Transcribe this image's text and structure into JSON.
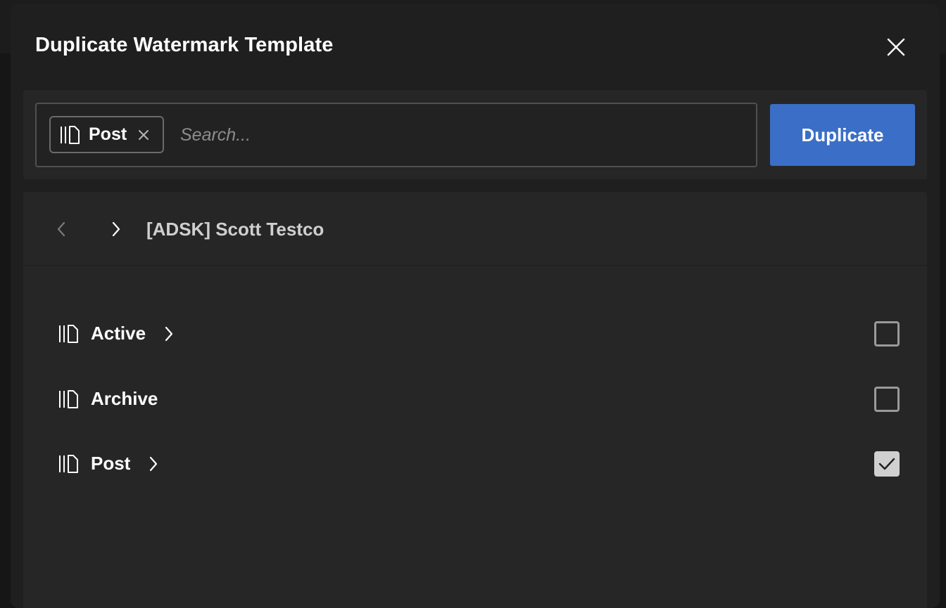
{
  "modal": {
    "title": "Duplicate Watermark Template"
  },
  "search": {
    "chip_label": "Post",
    "placeholder": "Search...",
    "value": ""
  },
  "actions": {
    "duplicate_label": "Duplicate"
  },
  "navigation": {
    "breadcrumb": "[ADSK] Scott Testco"
  },
  "list": {
    "items": [
      {
        "label": "Active",
        "icon": "folder-library-icon",
        "has_children": true,
        "checked": false
      },
      {
        "label": "Archive",
        "icon": "folder-library-icon",
        "has_children": false,
        "checked": false
      },
      {
        "label": "Post",
        "icon": "folder-library-icon",
        "has_children": true,
        "checked": true
      }
    ]
  },
  "colors": {
    "accent": "#3a6ec7",
    "modal_bg": "#1f1f1f",
    "panel_bg": "#262626"
  }
}
